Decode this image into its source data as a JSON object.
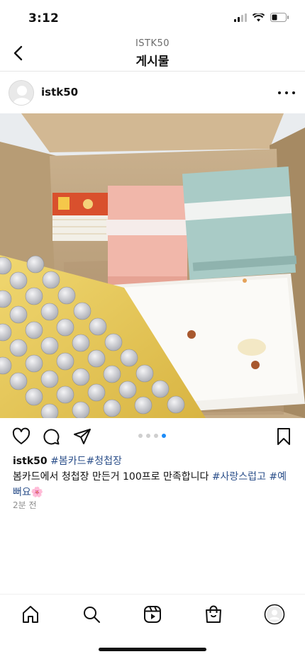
{
  "status_bar": {
    "time": "3:12"
  },
  "header": {
    "account_id": "ISTK50",
    "title": "게시물"
  },
  "post": {
    "username": "istk50",
    "caption_parts": [
      {
        "text": "#봄카드",
        "hashtag": true
      },
      {
        "text": "#청첩장",
        "hashtag": true
      },
      {
        "text": "봄카드에서 청첩장 만든거 100프로 만족합니다 ",
        "hashtag": false
      },
      {
        "text": "#사랑스럽고",
        "hashtag": true
      },
      {
        "text": "#예뻐요",
        "hashtag": true
      },
      {
        "text": "🌸",
        "hashtag": false
      }
    ],
    "time_ago": "2분 전",
    "carousel": {
      "total": 4,
      "active": 4
    }
  },
  "icons": {
    "back": "chevron-left-icon",
    "more": "more-horizontal-icon",
    "like": "heart-icon",
    "comment": "comment-icon",
    "share": "send-icon",
    "save": "bookmark-icon",
    "tabs": [
      "home-icon",
      "search-icon",
      "reels-icon",
      "shop-icon",
      "profile-icon"
    ]
  },
  "colors": {
    "hashtag": "#2b4f8a",
    "active_dot": "#1d8cf8",
    "text": "#111111",
    "muted": "#8e8e8e"
  }
}
